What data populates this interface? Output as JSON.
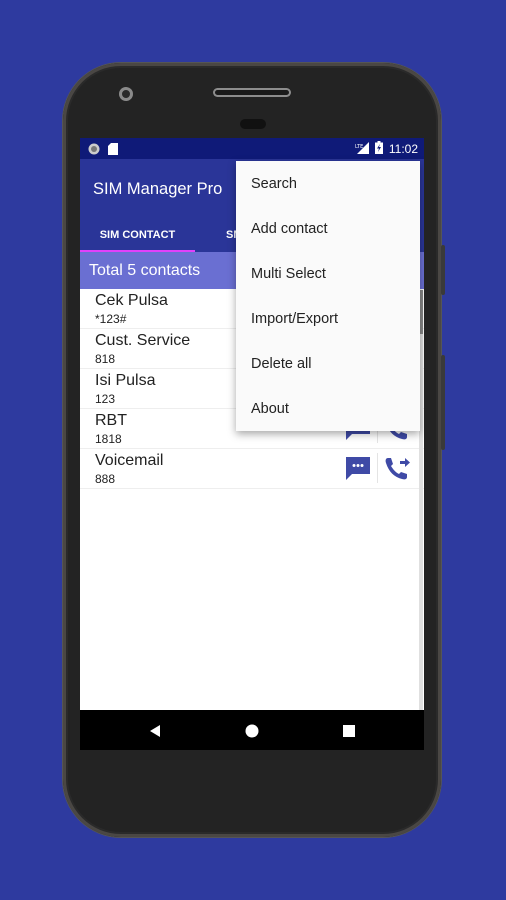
{
  "status_bar": {
    "time": "11:02",
    "left_icons": [
      "record-icon",
      "sd-card-icon"
    ],
    "right_icons": [
      "lte-signal-icon",
      "battery-charging-icon"
    ]
  },
  "app": {
    "title": "SIM Manager Pro",
    "tabs": [
      {
        "label": "SIM CONTACT",
        "active": true
      },
      {
        "label": "SMS",
        "active": false
      }
    ],
    "summary": "Total 5 contacts",
    "contacts": [
      {
        "name": "Cek Pulsa",
        "number": "*123#"
      },
      {
        "name": "Cust. Service",
        "number": "818"
      },
      {
        "name": "Isi Pulsa",
        "number": "123"
      },
      {
        "name": "RBT",
        "number": "1818"
      },
      {
        "name": "Voicemail",
        "number": "888"
      }
    ]
  },
  "overflow_menu": {
    "items": [
      "Search",
      "Add contact",
      "Multi Select",
      "Import/Export",
      "Delete all",
      "About"
    ]
  },
  "nav_bar": {
    "buttons": [
      "back",
      "home",
      "recents"
    ]
  },
  "colors": {
    "background": "#2e3a9f",
    "status_bar": "#0f1a78",
    "app_bar": "#2a3598",
    "summary_bar": "#6a6fd2",
    "tab_indicator": "#e040fb",
    "action_icon": "#3f4aa6"
  }
}
